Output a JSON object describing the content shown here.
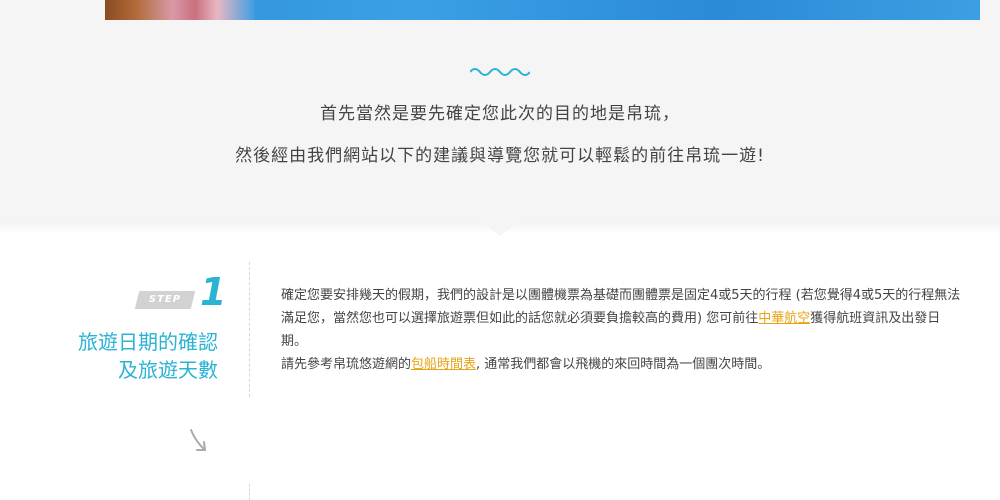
{
  "intro": {
    "line1": "首先當然是要先確定您此次的目的地是帛琉，",
    "line2": "然後經由我們網站以下的建議與導覽您就可以輕鬆的前往帛琉一遊!"
  },
  "step": {
    "label": "STEP",
    "number": "1",
    "title_line1": "旅遊日期的確認",
    "title_line2": "及旅遊天數"
  },
  "content": {
    "p1_before": "確定您要安排幾天的假期，我們的設計是以團體機票為基礎而團體票是固定4或5天的行程 (若您覺得4或5天的行程無法滿足您，當然您也可以選擇旅遊票但如此的話您就必須要負擔較高的費用) 您可前往",
    "p1_link": "中華航空",
    "p1_after": "獲得航班資訊及出發日期。",
    "p2_before": "請先參考帛琉悠遊網的",
    "p2_link": "包船時間表",
    "p2_after": ", 通常我們都會以飛機的來回時間為一個團次時間。"
  },
  "colors": {
    "accent": "#2ab3d3",
    "link": "#e8a314",
    "intro_bg": "#f5f5f5"
  },
  "icons": {
    "wave": "wave-divider-icon",
    "arrow": "arrow-down-right-icon"
  }
}
